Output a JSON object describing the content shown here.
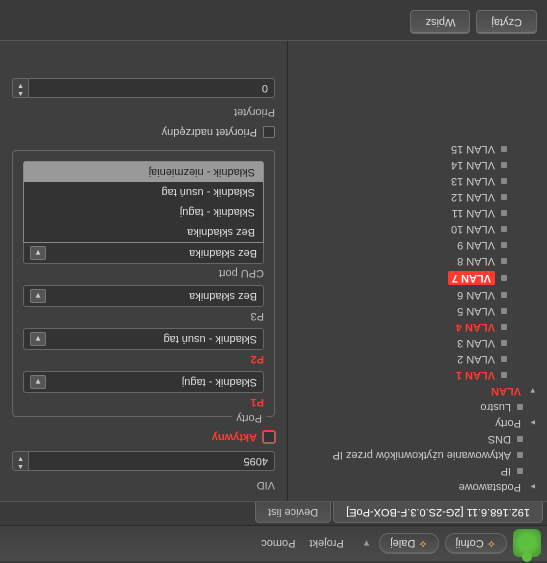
{
  "toolbar": {
    "back": "Cofnij",
    "forward": "Dalej",
    "menu": {
      "project": "Projekt",
      "help": "Pomoc"
    }
  },
  "tabs": {
    "active": "192.168.6.11 [2G-2S.0.3.F-BOX-PoE]",
    "other": "Device list"
  },
  "tree": {
    "root0": "Podstawowe",
    "root1": "IP",
    "root2": "Aktywowanie użytkowników przez IP",
    "root3": "DNS",
    "root4": "Porty",
    "root5": "Lustro",
    "root6": "VLAN",
    "vlans": [
      "VLAN 1",
      "VLAN 2",
      "VLAN 3",
      "VLAN 4",
      "VLAN 5",
      "VLAN 6",
      "VLAN 7",
      "VLAN 8",
      "VLAN 9",
      "VLAN 10",
      "VLAN 11",
      "VLAN 12",
      "VLAN 13",
      "VLAN 14",
      "VLAN 15"
    ]
  },
  "panel": {
    "vid_label": "VID",
    "vid_value": "4095",
    "active_label": "Aktywny",
    "ports_group": "Porty",
    "p1_label": "P1",
    "p1_value": "Składnik - taguj",
    "p2_label": "P2",
    "p2_value": "Składnik - usuń tag",
    "p3_label": "P3",
    "p3_value": "Bez składnika",
    "cpu_label": "CPU port",
    "cpu_value": "Bez składnika",
    "dropdown_opts": {
      "o0": "Bez składnika",
      "o1": "Składnik - taguj",
      "o2": "Składnik - usuń tag",
      "o3": "Składnik - niezmieniaj"
    },
    "priority_override_label": "Priorytet nadrzędny",
    "priority_label": "Priorytet",
    "priority_value": "0"
  },
  "buttons": {
    "read": "Czytaj",
    "write": "Wpisz"
  }
}
